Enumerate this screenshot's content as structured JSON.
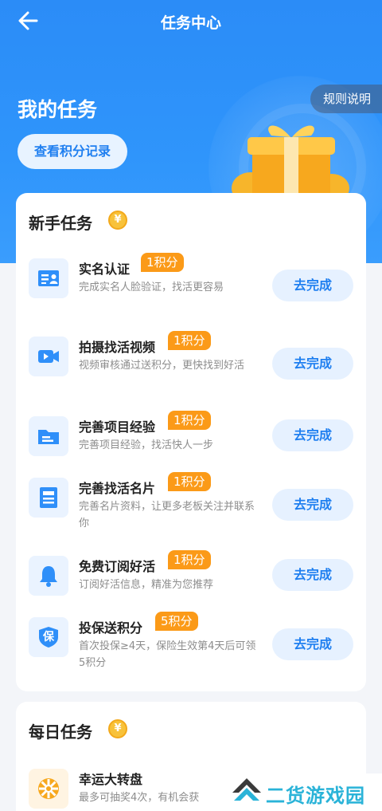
{
  "header": {
    "title": "任务中心"
  },
  "hero": {
    "heading": "我的任务",
    "rules_label": "规则说明",
    "points_record_label": "查看积分记录"
  },
  "newbie": {
    "title": "新手任务",
    "coin_symbol": "¥",
    "tasks": [
      {
        "name": "实名认证",
        "points": "1积分",
        "desc": "完成实名人脸验证，找活更容易",
        "action": "去完成",
        "icon": "id-card-icon"
      },
      {
        "name": "拍摄找活视频",
        "points": "1积分",
        "desc": "视频审核通过送积分，更快找到好活",
        "action": "去完成",
        "icon": "video-camera-icon"
      },
      {
        "name": "完善项目经验",
        "points": "1积分",
        "desc": "完善项目经验，找活快人一步",
        "action": "去完成",
        "icon": "folder-icon"
      },
      {
        "name": "完善找活名片",
        "points": "1积分",
        "desc": "完善名片资料，让更多老板关注并联系你",
        "action": "去完成",
        "icon": "document-icon"
      },
      {
        "name": "免费订阅好活",
        "points": "1积分",
        "desc": "订阅好活信息，精准为您推荐",
        "action": "去完成",
        "icon": "bell-icon"
      },
      {
        "name": "投保送积分",
        "points": "5积分",
        "desc": "首次投保≥4天，保险生效第4天后可领5积分",
        "action": "去完成",
        "icon": "shield-icon",
        "icon_text": "保"
      }
    ]
  },
  "daily": {
    "title": "每日任务",
    "coin_symbol": "¥",
    "tasks": [
      {
        "name": "幸运大转盘",
        "desc": "最多可抽奖4次，有机会获",
        "icon": "wheel-icon"
      }
    ]
  },
  "watermark": {
    "text": "二货游戏园"
  },
  "colors": {
    "primary": "#2f8ff9",
    "accent_orange": "#fb9a18",
    "button_bg": "#e6f1ff"
  }
}
